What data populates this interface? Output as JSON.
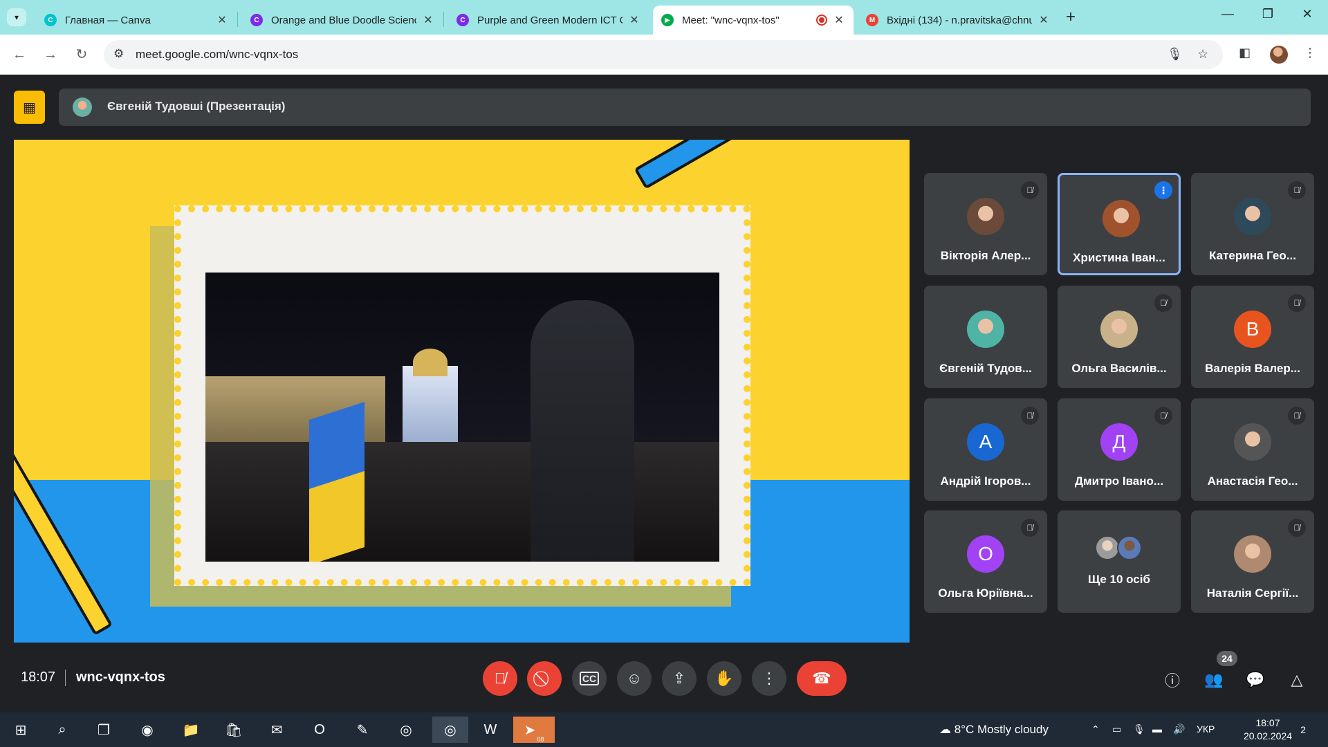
{
  "browser": {
    "tabs": [
      {
        "title": "Главная — Canva",
        "icon": "canva-icon",
        "color": "#00c4cc"
      },
      {
        "title": "Orange and Blue Doodle Scienc",
        "icon": "canva-icon",
        "color": "#7d2ae8"
      },
      {
        "title": "Purple and Green Modern ICT C",
        "icon": "canva-icon",
        "color": "#7d2ae8"
      },
      {
        "title": "Meet: \"wnc-vqnx-tos\"",
        "icon": "meet-icon",
        "color": "#00ac47"
      },
      {
        "title": "Вхідні (134) - n.pravitska@chnu",
        "icon": "gmail-icon",
        "color": "#ea4335"
      }
    ],
    "url": "meet.google.com/wnc-vqnx-tos"
  },
  "meet": {
    "presenter_label": "Євгеній Тудовші (Презентація)",
    "clock": "18:07",
    "meeting_code": "wnc-vqnx-tos",
    "participant_count": "24",
    "participants": [
      {
        "name": "Вікторія Алер...",
        "avatar": "photo",
        "color": "#6b4a3a",
        "muted": true
      },
      {
        "name": "Христина Іван...",
        "avatar": "photo",
        "color": "#a0522d",
        "muted": false,
        "speaking": true
      },
      {
        "name": "Катерина Гео...",
        "avatar": "photo",
        "color": "#2e4a5a",
        "muted": true
      },
      {
        "name": "Євгеній Тудов...",
        "avatar": "photo",
        "color": "#4fb3a6",
        "muted": false
      },
      {
        "name": "Ольга Василів...",
        "avatar": "photo",
        "color": "#c9b28a",
        "muted": true
      },
      {
        "name": "Валерія Валер...",
        "avatar": "В",
        "color": "#e8541e",
        "muted": true
      },
      {
        "name": "Андрій Ігоров...",
        "avatar": "А",
        "color": "#1967d2",
        "muted": true
      },
      {
        "name": "Дмитро Івано...",
        "avatar": "Д",
        "color": "#a142f4",
        "muted": true
      },
      {
        "name": "Анастасія Гео...",
        "avatar": "photo",
        "color": "#555555",
        "muted": true
      },
      {
        "name": "Ольга Юріївна...",
        "avatar": "О",
        "color": "#a142f4",
        "muted": true
      },
      {
        "name": "Ще 10 осіб",
        "avatar": "group",
        "color": "#8a8a8a",
        "muted": false
      },
      {
        "name": "Наталія Сергії...",
        "avatar": "photo",
        "color": "#b08a70",
        "muted": true
      }
    ]
  },
  "taskbar": {
    "weather": "8°C  Mostly cloudy",
    "lang": "УКР",
    "time": "18:07",
    "date": "20.02.2024",
    "notifications": "2",
    "telegram_badge": "08"
  },
  "colors": {
    "slide_yellow": "#fcd22f",
    "slide_blue": "#2196ea",
    "end_call": "#ea4335",
    "speaking_border": "#8ab4f8"
  }
}
